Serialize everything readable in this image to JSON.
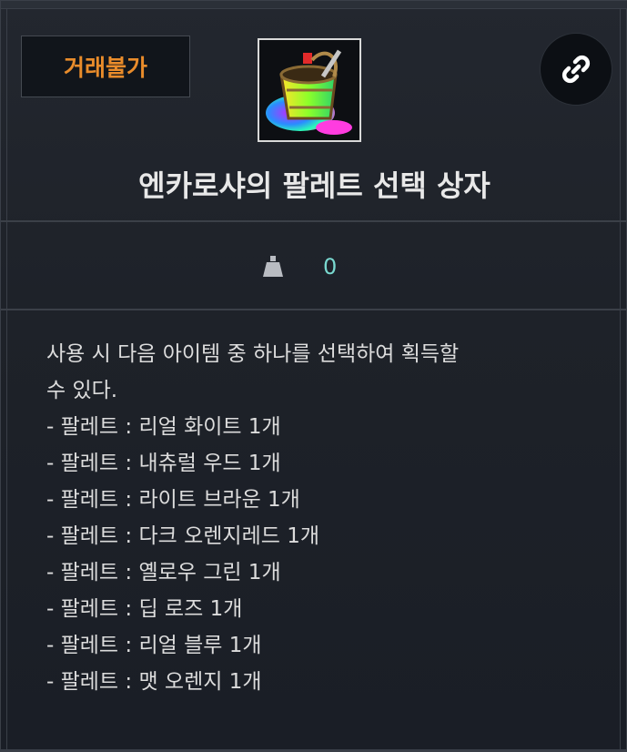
{
  "item": {
    "trade_badge": "거래불가",
    "title": "엔카로샤의 팔레트 선택 상자",
    "weight_value": "0",
    "icon_name": "paint-bucket-icon",
    "link_icon_name": "link-icon"
  },
  "description": {
    "intro_line1": "사용 시 다음 아이템 중 하나를 선택하여 획득할",
    "intro_line2": "수 있다.",
    "options": [
      "- 팔레트 : 리얼 화이트 1개",
      "- 팔레트 : 내츄럴 우드 1개",
      "- 팔레트 : 라이트 브라운 1개",
      "- 팔레트 : 다크 오렌지레드 1개",
      "- 팔레트 : 옐로우 그린 1개",
      "- 팔레트 : 딥 로즈 1개",
      "- 팔레트 : 리얼 블루 1개",
      "- 팔레트 : 맷 오렌지 1개"
    ]
  },
  "colors": {
    "badge_text": "#e98c2b",
    "weight_value": "#79d8cf",
    "background": "#1b1f26"
  }
}
